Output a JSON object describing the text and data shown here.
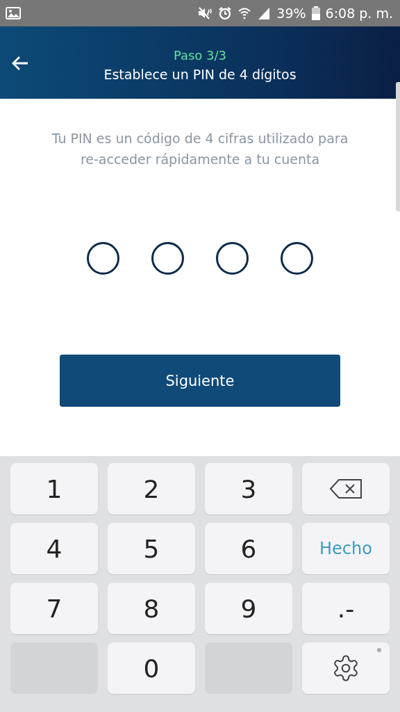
{
  "status_bar": {
    "battery": "39%",
    "time": "6:08 p. m."
  },
  "header": {
    "step": "Paso 3/3",
    "title": "Establece un PIN de 4 dígitos"
  },
  "description": "Tu PIN es un código de 4 cifras utilizado para re-acceder rápidamente a tu cuenta",
  "pin": [
    {
      "filled": false
    },
    {
      "filled": false
    },
    {
      "filled": false
    },
    {
      "filled": false
    }
  ],
  "next_button": "Siguiente",
  "keyboard": [
    {
      "kind": "digit",
      "label": "1"
    },
    {
      "kind": "digit",
      "label": "2"
    },
    {
      "kind": "digit",
      "label": "3"
    },
    {
      "kind": "backspace"
    },
    {
      "kind": "digit",
      "label": "4"
    },
    {
      "kind": "digit",
      "label": "5"
    },
    {
      "kind": "digit",
      "label": "6"
    },
    {
      "kind": "action",
      "label": "Hecho"
    },
    {
      "kind": "digit",
      "label": "7"
    },
    {
      "kind": "digit",
      "label": "8"
    },
    {
      "kind": "digit",
      "label": "9"
    },
    {
      "kind": "digit",
      "label": ".-"
    },
    {
      "kind": "blank"
    },
    {
      "kind": "digit",
      "label": "0"
    },
    {
      "kind": "blank"
    },
    {
      "kind": "settings"
    }
  ]
}
